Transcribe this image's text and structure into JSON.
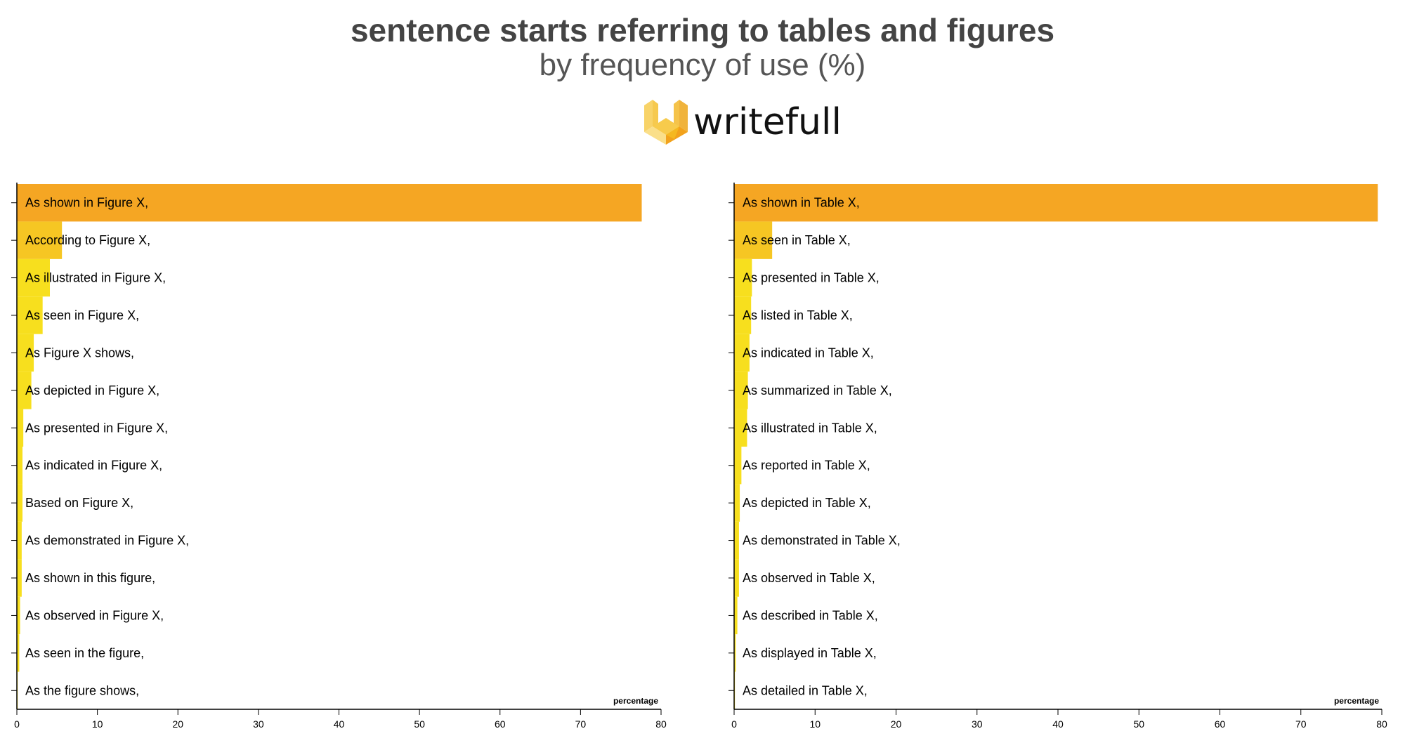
{
  "title": "sentence starts referring to tables and figures",
  "subtitle": "by frequency of use (%)",
  "logo": {
    "text": "writefull"
  },
  "colors": {
    "top": "#F5A623",
    "second": "#F6C623",
    "rest": "#F7DF1E",
    "axis": "#000000",
    "title": "#444444"
  },
  "chart_data": [
    {
      "type": "bar",
      "orientation": "horizontal",
      "xlabel": "percentage",
      "xlim": [
        0,
        80
      ],
      "xticks": [
        0,
        10,
        20,
        30,
        40,
        50,
        60,
        70,
        80
      ],
      "categories": [
        "As shown in Figure X,",
        "According to Figure X,",
        "As illustrated in Figure X,",
        "As seen in Figure X,",
        "As Figure X shows,",
        "As depicted in Figure X,",
        "As presented in Figure X,",
        "As indicated in Figure X,",
        "Based on Figure X,",
        "As demonstrated in Figure X,",
        "As shown in this figure,",
        "As observed in Figure X,",
        "As seen in the figure,",
        "As the figure shows,"
      ],
      "values": [
        77.6,
        5.6,
        4.1,
        3.2,
        2.1,
        1.8,
        0.8,
        0.7,
        0.7,
        0.6,
        0.6,
        0.4,
        0.3,
        0.1
      ]
    },
    {
      "type": "bar",
      "orientation": "horizontal",
      "xlabel": "percentage",
      "xlim": [
        0,
        80
      ],
      "xticks": [
        0,
        10,
        20,
        30,
        40,
        50,
        60,
        70,
        80
      ],
      "categories": [
        "As shown in Table X,",
        "As seen in Table X,",
        "As presented in Table X,",
        "As listed in Table X,",
        "As indicated in Table X,",
        "As summarized in Table X,",
        "As illustrated in Table X,",
        "As reported in Table X,",
        "As depicted in Table X,",
        "As demonstrated in Table X,",
        "As observed in Table X,",
        "As described in Table X,",
        "As displayed in Table X,",
        "As detailed in Table X,"
      ],
      "values": [
        79.5,
        4.7,
        2.2,
        2.1,
        1.9,
        1.7,
        1.6,
        0.9,
        0.7,
        0.6,
        0.6,
        0.4,
        0.2,
        0.1
      ]
    }
  ]
}
